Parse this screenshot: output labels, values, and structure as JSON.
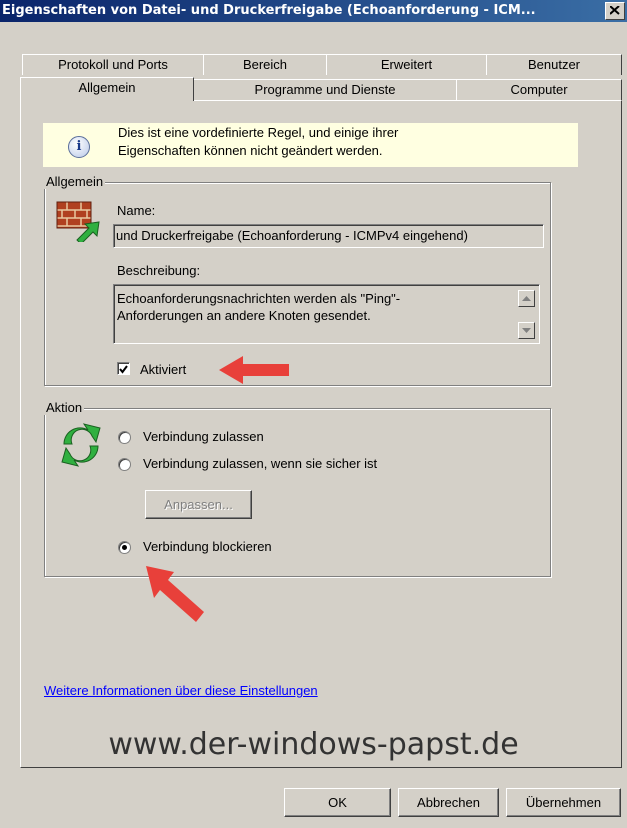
{
  "window": {
    "title": "Eigenschaften von Datei- und Druckerfreigabe (Echoanforderung - ICM..."
  },
  "tabs_back": [
    {
      "label": "Protokoll und Ports"
    },
    {
      "label": "Bereich"
    },
    {
      "label": "Erweitert"
    },
    {
      "label": "Benutzer"
    }
  ],
  "tabs_front": [
    {
      "label": "Allgemein",
      "active": true
    },
    {
      "label": "Programme und Dienste"
    },
    {
      "label": "Computer"
    }
  ],
  "info": {
    "line1": "Dies ist eine vordefinierte Regel, und einige ihrer",
    "line2": "Eigenschaften können nicht geändert werden."
  },
  "general": {
    "group_label": "Allgemein",
    "name_label": "Name:",
    "name_value": "und Druckerfreigabe (Echoanforderung - ICMPv4 eingehend)",
    "desc_label": "Beschreibung:",
    "desc_line1": "Echoanforderungsnachrichten werden als \"Ping\"-",
    "desc_line2": "Anforderungen an andere Knoten gesendet.",
    "enabled_label": "Aktiviert",
    "enabled_checked": true
  },
  "action": {
    "group_label": "Aktion",
    "opt_allow": "Verbindung zulassen",
    "opt_allow_secure": "Verbindung zulassen, wenn sie sicher ist",
    "customize_label": "Anpassen...",
    "opt_block": "Verbindung blockieren",
    "selected": "block"
  },
  "more_info_link": "Weitere Informationen über diese Einstellungen",
  "watermark": "www.der-windows-papst.de",
  "buttons": {
    "ok": "OK",
    "cancel": "Abbrechen",
    "apply": "Übernehmen"
  },
  "colors": {
    "arrow": "#e8403a",
    "title_bar": "#0a246a",
    "info_bg": "#ffffe1"
  }
}
